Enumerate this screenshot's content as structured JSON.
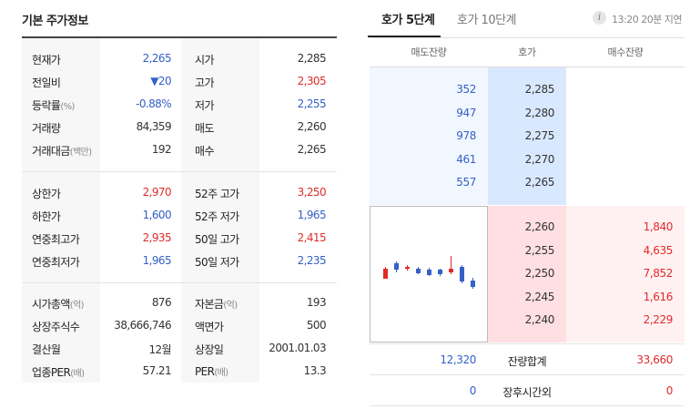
{
  "left": {
    "title": "기본 주가정보",
    "basic": [
      {
        "l1": "현재가",
        "v1": "2,265",
        "c1": "blue",
        "l2": "시가",
        "v2": "2,285",
        "c2": "dark"
      },
      {
        "l1": "전일비",
        "v1": "▼20",
        "c1": "blue",
        "l2": "고가",
        "v2": "2,305",
        "c2": "red"
      },
      {
        "l1": "등락률",
        "u1": "(%)",
        "v1": "-0.88%",
        "c1": "blue",
        "l2": "저가",
        "v2": "2,255",
        "c2": "blue"
      },
      {
        "l1": "거래량",
        "v1": "84,359",
        "c1": "dark",
        "l2": "매도",
        "v2": "2,260",
        "c2": "dark"
      },
      {
        "l1": "거래대금",
        "u1": "(백만)",
        "v1": "192",
        "c1": "dark",
        "l2": "매수",
        "v2": "2,265",
        "c2": "dark"
      }
    ],
    "range": [
      {
        "l1": "상한가",
        "v1": "2,970",
        "c1": "red",
        "l2": "52주 고가",
        "v2": "3,250",
        "c2": "red"
      },
      {
        "l1": "하한가",
        "v1": "1,600",
        "c1": "blue",
        "l2": "52주 저가",
        "v2": "1,965",
        "c2": "blue"
      },
      {
        "l1": "연중최고가",
        "v1": "2,935",
        "c1": "red",
        "l2": "50일 고가",
        "v2": "2,415",
        "c2": "red"
      },
      {
        "l1": "연중최저가",
        "v1": "1,965",
        "c1": "blue",
        "l2": "50일 저가",
        "v2": "2,235",
        "c2": "blue"
      }
    ],
    "company": [
      {
        "l1": "시가총액",
        "u1": "(억)",
        "v1": "876",
        "c1": "dark",
        "l2": "자본금",
        "u2": "(억)",
        "v2": "193",
        "c2": "dark"
      },
      {
        "l1": "상장주식수",
        "v1": "38,666,746",
        "c1": "dark",
        "l2": "액면가",
        "v2": "500",
        "c2": "dark"
      },
      {
        "l1": "결산월",
        "v1": "12월",
        "c1": "dark",
        "l2": "상장일",
        "v2": "2001.01.03",
        "c2": "dark"
      },
      {
        "l1": "업종PER",
        "u1": "(배)",
        "v1": "57.21",
        "c1": "dark",
        "l2": "PER",
        "u2": "(배)",
        "v2": "13.3",
        "c2": "dark"
      }
    ]
  },
  "right": {
    "tabs": [
      {
        "label": "호가 5단계",
        "active": true
      },
      {
        "label": "호가 10단계",
        "active": false
      }
    ],
    "info_icon": "i",
    "delay_text": "13:20 20분 지연",
    "headers": {
      "ask_qty": "매도잔량",
      "price": "호가",
      "bid_qty": "매수잔량"
    },
    "asks": [
      {
        "qty": "352",
        "price": "2,285"
      },
      {
        "qty": "947",
        "price": "2,280"
      },
      {
        "qty": "978",
        "price": "2,275"
      },
      {
        "qty": "461",
        "price": "2,270"
      },
      {
        "qty": "557",
        "price": "2,265"
      }
    ],
    "bids": [
      {
        "price": "2,260",
        "qty": "1,840"
      },
      {
        "price": "2,255",
        "qty": "4,635"
      },
      {
        "price": "2,250",
        "qty": "7,852"
      },
      {
        "price": "2,245",
        "qty": "1,616"
      },
      {
        "price": "2,240",
        "qty": "2,229"
      }
    ],
    "total": {
      "ask": "12,320",
      "label": "잔량합계",
      "bid": "33,660"
    },
    "after_hours": {
      "ask": "0",
      "label": "장후시간외",
      "bid": "0"
    },
    "colors": {
      "up": "#e02b2b",
      "down": "#3560c6"
    },
    "mini_chart": {
      "type": "candlestick",
      "candles": [
        {
          "dir": "up"
        },
        {
          "dir": "down"
        },
        {
          "dir": "up"
        },
        {
          "dir": "down"
        },
        {
          "dir": "down"
        },
        {
          "dir": "down"
        },
        {
          "dir": "up"
        },
        {
          "dir": "down"
        },
        {
          "dir": "down"
        }
      ]
    }
  }
}
